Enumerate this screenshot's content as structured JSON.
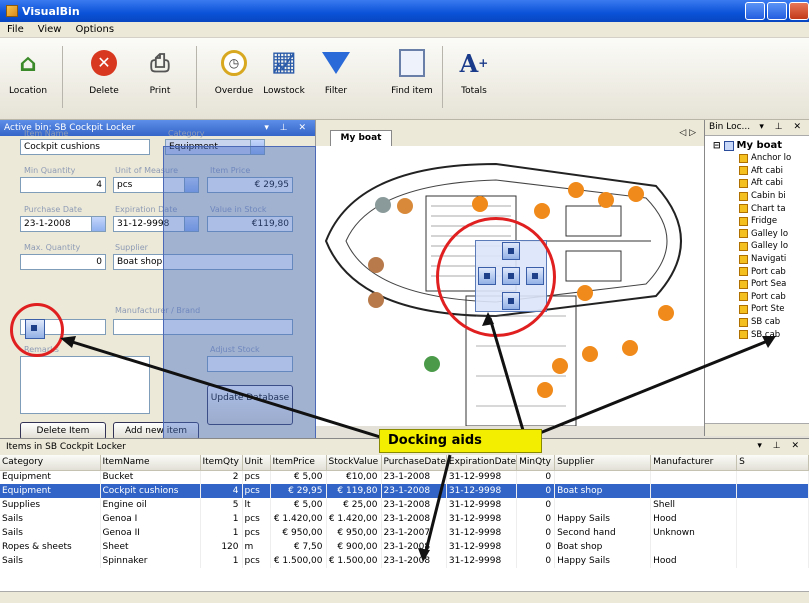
{
  "window": {
    "title": "VisualBin"
  },
  "menu": [
    "File",
    "View",
    "Options"
  ],
  "toolbar": {
    "location": "Location",
    "delete": "Delete",
    "print": "Print",
    "overdue": "Overdue",
    "lowstock": "Lowstock",
    "filter": "Filter",
    "find_item": "Find item",
    "totals": "Totals"
  },
  "active_bin": {
    "header": "Active bin: SB Cockpit Locker",
    "item_name_label": "Item Name",
    "item_name": "Cockpit cushions",
    "category_label": "Category",
    "category": "Equipment",
    "min_qty_label": "Min Quantity",
    "min_qty": "4",
    "unit_label": "Unit of Measure",
    "unit": "pcs",
    "item_price_label": "Item Price",
    "item_price": "€ 29,95",
    "purchase_date_label": "Purchase Date",
    "purchase_date": "23-1-2008",
    "expiration_date_label": "Expiration Date",
    "expiration_date": "31-12-9998",
    "value_label": "Value in Stock",
    "value": "€119,80",
    "max_qty_label": "Max. Quantity",
    "max_qty": "0",
    "supplier_label": "Supplier",
    "supplier": "Boat shop",
    "manufacturer_label": "Manufacturer / Brand",
    "remarks_label": "Remarks",
    "adjust_label": "Adjust Stock",
    "update_db": "Update Database",
    "delete_item": "Delete Item",
    "add_new_item": "Add new item"
  },
  "document_tab": {
    "label": "My boat",
    "nav": "◁ ▷"
  },
  "bin_locations": {
    "header": "Bin Loc...",
    "root": "My boat",
    "items": [
      "Anchor lo",
      "Aft cabi",
      "Aft cabi",
      "Cabin bi",
      "Chart ta",
      "Fridge",
      "Galley lo",
      "Galley lo",
      "Navigati",
      "Port cab",
      "Port Sea",
      "Port cab",
      "Port Ste",
      "SB cab",
      "SB cab"
    ]
  },
  "items_grid": {
    "header": "Items in SB Cockpit Locker",
    "columns": [
      "Category",
      "ItemName",
      "ItemQty",
      "Unit",
      "ItemPrice",
      "StockValue",
      "PurchaseDate",
      "ExpirationDate",
      "MinQty",
      "Supplier",
      "Manufacturer",
      "S"
    ],
    "rows": [
      [
        "Equipment",
        "Bucket",
        "2",
        "pcs",
        "€ 5,00",
        "€10,00",
        "23-1-2008",
        "31-12-9998",
        "0",
        "",
        "",
        ""
      ],
      [
        "Equipment",
        "Cockpit cushions",
        "4",
        "pcs",
        "€ 29,95",
        "€ 119,80",
        "23-1-2008",
        "31-12-9998",
        "0",
        "Boat shop",
        "",
        ""
      ],
      [
        "Supplies",
        "Engine oil",
        "5",
        "lt",
        "€ 5,00",
        "€ 25,00",
        "23-1-2008",
        "31-12-9998",
        "0",
        "",
        "Shell",
        ""
      ],
      [
        "Sails",
        "Genoa I",
        "1",
        "pcs",
        "€ 1.420,00",
        "€ 1.420,00",
        "23-1-2008",
        "31-12-9998",
        "0",
        "Happy Sails",
        "Hood",
        ""
      ],
      [
        "Sails",
        "Genoa II",
        "1",
        "pcs",
        "€ 950,00",
        "€ 950,00",
        "23-1-2007",
        "31-12-9998",
        "0",
        "Second hand",
        "Unknown",
        ""
      ],
      [
        "Ropes & sheets",
        "Sheet",
        "120",
        "m",
        "€ 7,50",
        "€ 900,00",
        "23-1-2008",
        "31-12-9998",
        "0",
        "Boat shop",
        "",
        ""
      ],
      [
        "Sails",
        "Spinnaker",
        "1",
        "pcs",
        "€ 1.500,00",
        "€ 1.500,00",
        "23-1-2008",
        "31-12-9998",
        "0",
        "Happy Sails",
        "Hood",
        ""
      ]
    ]
  },
  "annotation": "Docking aids"
}
